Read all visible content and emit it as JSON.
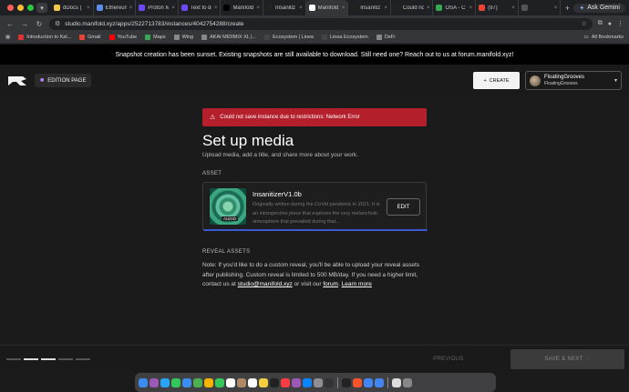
{
  "browser": {
    "tabs": [
      {
        "label": "dDocs |",
        "color": "#f2c94c",
        "active": false
      },
      {
        "label": "Ethereum",
        "color": "#5b8def",
        "active": false
      },
      {
        "label": "Proton M",
        "color": "#6d4aff",
        "active": false
      },
      {
        "label": "Text to di",
        "color": "#6d4aff",
        "active": false
      },
      {
        "label": "Manifold",
        "color": "#000000",
        "active": false
      },
      {
        "label": "Insanitiz",
        "color": "#222222",
        "active": false
      },
      {
        "label": "Manifold",
        "color": "#ffffff",
        "active": true
      },
      {
        "label": "Insanitiz",
        "color": "#222222",
        "active": false
      },
      {
        "label": "Could no",
        "color": "#222222",
        "active": false
      },
      {
        "label": "OSA - C",
        "color": "#34a853",
        "active": false
      },
      {
        "label": "(97)",
        "color": "#ea4335",
        "active": false
      },
      {
        "label": "",
        "color": "#555555",
        "active": false
      }
    ],
    "ask_gemini": "Ask Gemini",
    "url": "studio.manifold.xyz/apps/2522713783/instances/4042754288/create",
    "bookmarks": [
      {
        "label": "Introduction to Kal...",
        "color": "#d33"
      },
      {
        "label": "Gmail",
        "color": "#ea4335"
      },
      {
        "label": "YouTube",
        "color": "#ff0000"
      },
      {
        "label": "Maps",
        "color": "#34a853"
      },
      {
        "label": "Wing",
        "color": "#888"
      },
      {
        "label": "AKAI MIDIMIX XL |...",
        "color": "#888"
      },
      {
        "label": "Ecosystem | Linea",
        "color": "#444"
      },
      {
        "label": "Linea Ecosystem",
        "color": "#444"
      },
      {
        "label": "DeFi",
        "color": "#888"
      }
    ],
    "all_bookmarks": "All Bookmarks"
  },
  "banner": "Snapshot creation has been sunset. Existing snapshots are still available to download. Still need one? Reach out to us at forum.manifold.xyz!",
  "header": {
    "edition_label": "EDITION PAGE",
    "create_label": "CREATE",
    "user_name": "FloatingGrooves",
    "user_handle": "FloatingGrooves"
  },
  "main": {
    "error": "Could not save instance due to restrictions: Network Error",
    "title": "Set up media",
    "subtitle": "Upload media, add a title, and share more about your work.",
    "asset_label": "ASSET",
    "asset": {
      "title": "InsanitizerV1.0b",
      "description": "Originally written during the CoVid pandemic in 2021. It is an introspective piece that explores the very melancholic atmosphere that prevailed during that...",
      "tag": "AUDIO",
      "edit_label": "EDIT"
    },
    "reveal_label": "REVEAL ASSETS",
    "reveal_note_1": "Note: If you'd like to do a custom reveal, you'll be able to upload your reveal assets after publishing. Custom reveal is limited to 500 MB/day. If you need a higher limit, contact us at",
    "reveal_email": "studio@manifold.xyz",
    "reveal_mid": "or visit our",
    "reveal_forum": "forum",
    "reveal_learn": "Learn more"
  },
  "footer": {
    "previous_label": "PREVIOUS",
    "next_label": "SAVE & NEXT",
    "steps_total": 5,
    "steps_active": [
      1,
      2
    ]
  },
  "dock": {
    "icons": [
      "finder-icon",
      "launchpad-icon",
      "safari-icon",
      "messages-icon",
      "mail-icon",
      "maps-icon",
      "photos-icon",
      "facetime-icon",
      "calendar-icon",
      "contacts-icon",
      "reminders-icon",
      "notes-icon",
      "tv-icon",
      "music-icon",
      "podcasts-icon",
      "appstore-icon",
      "settings-icon",
      "logic-icon",
      "terminal-icon",
      "brave-icon",
      "chrome-icon",
      "docs-icon",
      "preview-icon",
      "trash-icon"
    ],
    "colors": [
      "#3b8ef0",
      "#9b59b6",
      "#2aa4f4",
      "#34c759",
      "#3b8ef0",
      "#4caf50",
      "#f4b400",
      "#34c759",
      "#ffffff",
      "#b08968",
      "#ffffff",
      "#f4d03f",
      "#222222",
      "#fc3c44",
      "#9b59b6",
      "#0a84ff",
      "#8e8e93",
      "#333333",
      "#222222",
      "#fb542b",
      "#4285f4",
      "#4285f4",
      "#dddddd",
      "#888888"
    ]
  }
}
